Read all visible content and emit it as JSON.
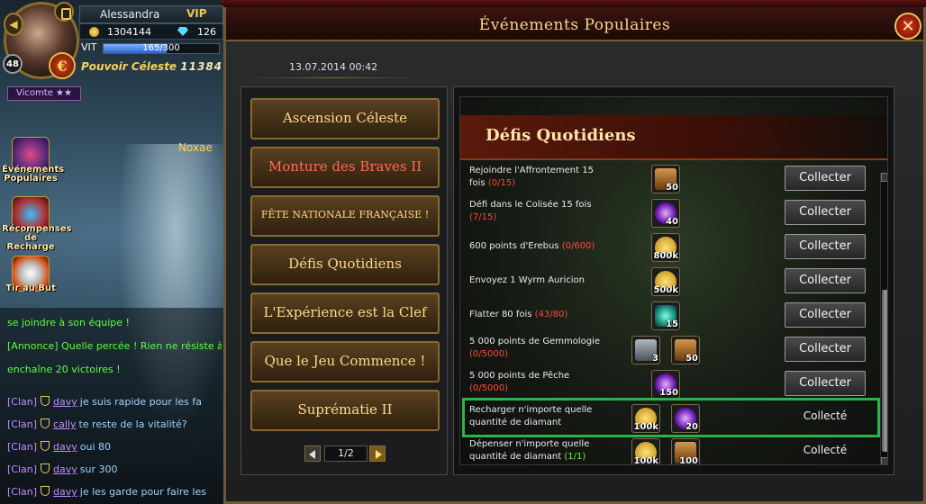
{
  "player": {
    "name": "Alessandra",
    "vip": "VIP",
    "gold": "1304144",
    "diamonds": "126",
    "vit_label": "VIT",
    "vit_text": "165/300",
    "vit_fraction": 0.55,
    "level": "48",
    "power_label": "Pouvoir Céleste",
    "power_value": "11384",
    "rank": "Vicomte ★★",
    "coin_symbol": "€"
  },
  "side_icons": [
    {
      "label": "Événements Populaires",
      "icon": "events-icon"
    },
    {
      "label": "Récompenses de Recharge",
      "icon": "recharge-gift-icon"
    },
    {
      "label": "Tir au But",
      "icon": "soccer-ball-icon"
    }
  ],
  "scene_label": "Noxae",
  "chat": [
    {
      "text": "se joindre à son équipe !"
    },
    {
      "text": "[Annonce] Quelle percée ! Rien ne résiste à"
    },
    {
      "text": "enchaîne 20 victoires !"
    },
    {
      "channel": "[Clan]",
      "user": "davy",
      "message": "je suis rapide pour les fa"
    },
    {
      "channel": "[Clan]",
      "user": "cally",
      "message": "te reste de la vitalité?"
    },
    {
      "channel": "[Clan]",
      "user": "davy",
      "message": "oui 80"
    },
    {
      "channel": "[Clan]",
      "user": "davy",
      "message": "sur 300"
    },
    {
      "channel": "[Clan]",
      "user": "davy",
      "message": "je les garde pour faire les"
    }
  ],
  "dialog": {
    "title": "Événements Populaires",
    "date": "13.07.2014 00:42",
    "close_symbol": "✕"
  },
  "menu": [
    {
      "label": "Ascension Céleste"
    },
    {
      "label": "Monture des Braves II"
    },
    {
      "label": "FÊTE NATIONALE FRANÇAISE !"
    },
    {
      "label": "Défis Quotidiens"
    },
    {
      "label": "L'Expérience est la Clef"
    },
    {
      "label": "Que le Jeu Commence !"
    },
    {
      "label": "Suprématie II"
    }
  ],
  "pager": {
    "text": "1/2"
  },
  "content": {
    "title": "Défis Quotidiens",
    "rows": [
      {
        "text": "Rejoindre l'Affrontement 15 fois",
        "progress": "(0/15)",
        "rewards": [
          {
            "icon": "gold-chest-icon",
            "qty": "50"
          }
        ],
        "action": "Collecter"
      },
      {
        "text": "Défi dans le Colisée 15 fois",
        "progress": "(7/15)",
        "rewards": [
          {
            "icon": "purple-orb-icon",
            "qty": "40"
          }
        ],
        "action": "Collecter"
      },
      {
        "text": "600 points d'Erebus",
        "progress": "(0/600)",
        "rewards": [
          {
            "icon": "gold-coin-icon",
            "qty": "800k"
          }
        ],
        "action": "Collecter"
      },
      {
        "text": "Envoyez 1 Wyrm Auricion",
        "progress": "",
        "rewards": [
          {
            "icon": "gold-coin-icon",
            "qty": "500k"
          }
        ],
        "action": "Collecter"
      },
      {
        "text": "Flatter 80 fois",
        "progress": "(43/80)",
        "rewards": [
          {
            "icon": "crystal-icon",
            "qty": "15"
          }
        ],
        "action": "Collecter"
      },
      {
        "text": "5 000 points de Gemmologie",
        "progress": "(0/5000)",
        "rewards": [
          {
            "icon": "scroll-icon",
            "qty": "3"
          },
          {
            "icon": "gold-chest-icon",
            "qty": "50"
          }
        ],
        "action": "Collecter"
      },
      {
        "text": "5 000 points de Pêche",
        "progress": "(0/5000)",
        "rewards": [
          {
            "icon": "purple-orb-icon",
            "qty": "150"
          }
        ],
        "action": "Collecter"
      },
      {
        "text": "Recharger n'importe quelle quantité de diamant",
        "progress": "",
        "rewards": [
          {
            "icon": "gold-coin-icon",
            "qty": "100k"
          },
          {
            "icon": "purple-orb-icon",
            "qty": "20"
          }
        ],
        "status": "Collecté"
      },
      {
        "text": "Dépenser n'importe quelle quantité de diamant",
        "progress": "(1/1)",
        "rewards": [
          {
            "icon": "gold-coin-icon",
            "qty": "100k"
          },
          {
            "icon": "treasure-chest-icon",
            "qty": "100"
          }
        ],
        "status": "Collecté"
      }
    ]
  },
  "colors": {
    "highlight": "#2db34a",
    "progress_incomplete": "#ff4a3a",
    "progress_complete": "#5dff3a",
    "title_gold": "#f6d68a"
  }
}
